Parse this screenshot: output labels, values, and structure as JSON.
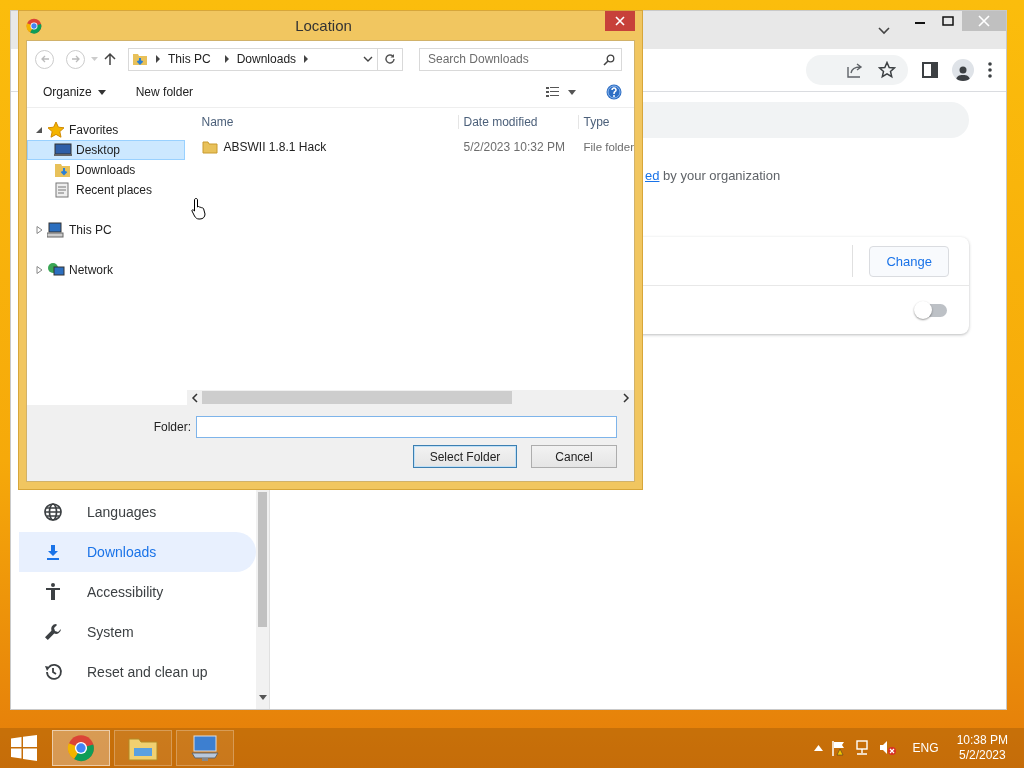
{
  "chrome_window": {
    "sidebar": {
      "items": [
        {
          "label": "Languages",
          "selected": false
        },
        {
          "label": "Downloads",
          "selected": true
        },
        {
          "label": "Accessibility",
          "selected": false
        },
        {
          "label": "System",
          "selected": false
        },
        {
          "label": "Reset and clean up",
          "selected": false
        }
      ]
    },
    "main": {
      "link_fragment": "ed",
      "managed_text": "by your organization",
      "change_button": "Change",
      "toggle": {
        "on": false
      }
    }
  },
  "dialog": {
    "title": "Location",
    "breadcrumb": [
      "This PC",
      "Downloads"
    ],
    "search": {
      "placeholder": "Search Downloads"
    },
    "commands": [
      "Organize",
      "New folder"
    ],
    "nav": [
      {
        "label": "Favorites",
        "expanded": true,
        "selected": false,
        "children": [
          {
            "label": "Desktop",
            "selected": true
          },
          {
            "label": "Downloads",
            "selected": false
          },
          {
            "label": "Recent places",
            "selected": false
          }
        ]
      },
      {
        "label": "This PC",
        "expanded": false,
        "selected": false
      },
      {
        "label": "Network",
        "expanded": false,
        "selected": false
      }
    ],
    "columns": [
      "Name",
      "Date modified",
      "Type"
    ],
    "rows": [
      {
        "name": "ABSWII 1.8.1 Hack",
        "date": "5/2/2023 10:32 PM",
        "type": "File folder"
      }
    ],
    "folder_field": {
      "label": "Folder:"
    },
    "buttons": [
      {
        "label": "Select Folder",
        "default": true
      },
      {
        "label": "Cancel",
        "default": false
      }
    ]
  },
  "taskbar": {
    "apps": [
      {
        "selected": true
      },
      {
        "selected": false
      },
      {
        "selected": false
      }
    ],
    "language": "ENG",
    "time": "10:38 PM",
    "date": "5/2/2023"
  }
}
